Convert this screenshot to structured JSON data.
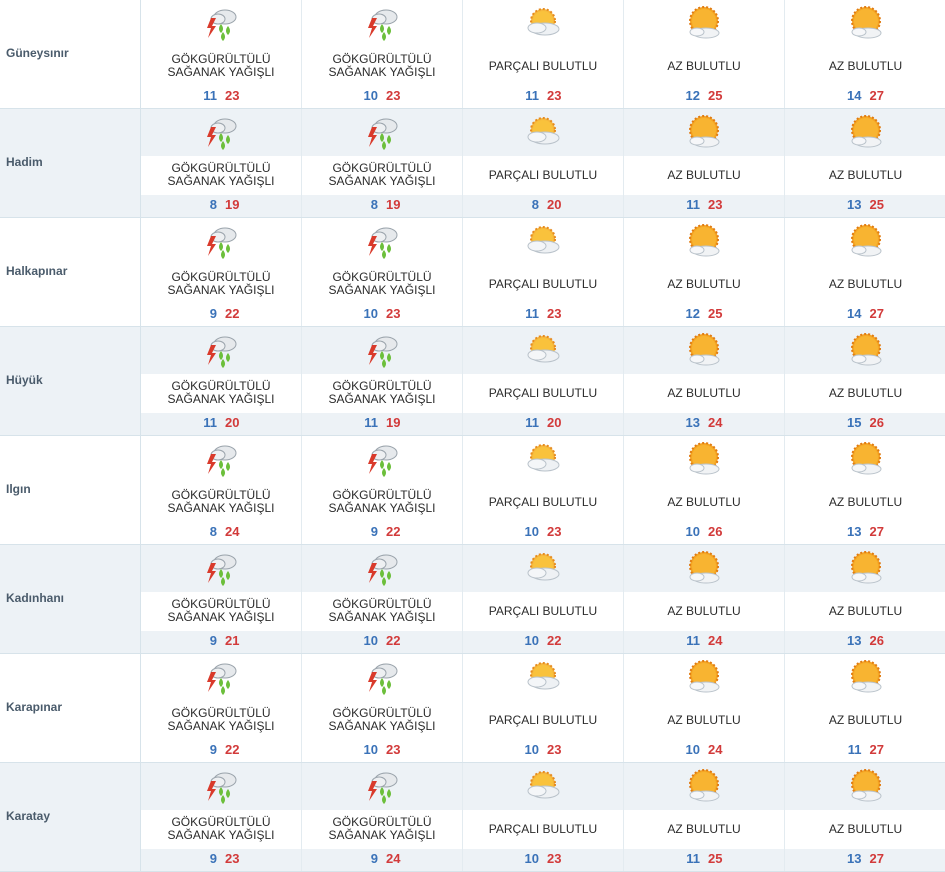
{
  "conditions": {
    "storm": "GÖKGÜRÜLTÜLÜ SAĞANAK YAĞIŞLI",
    "partly": "PARÇALI BULUTLU",
    "few": "AZ BULUTLU"
  },
  "rows": [
    {
      "name": "Güneysınır",
      "shaded": false,
      "days": [
        {
          "icon": "thunderstorm-icon",
          "cond": "GÖKGÜRÜLTÜLÜ SAĞANAK YAĞIŞLI",
          "min": "11",
          "max": "23"
        },
        {
          "icon": "thunderstorm-icon",
          "cond": "GÖKGÜRÜLTÜLÜ SAĞANAK YAĞIŞLI",
          "min": "10",
          "max": "23"
        },
        {
          "icon": "partly-cloudy-icon",
          "cond": "PARÇALI BULUTLU",
          "min": "11",
          "max": "23"
        },
        {
          "icon": "few-clouds-icon",
          "cond": "AZ BULUTLU",
          "min": "12",
          "max": "25"
        },
        {
          "icon": "few-clouds-icon",
          "cond": "AZ BULUTLU",
          "min": "14",
          "max": "27"
        }
      ]
    },
    {
      "name": "Hadim",
      "shaded": true,
      "days": [
        {
          "icon": "thunderstorm-icon",
          "cond": "GÖKGÜRÜLTÜLÜ SAĞANAK YAĞIŞLI",
          "min": "8",
          "max": "19"
        },
        {
          "icon": "thunderstorm-icon",
          "cond": "GÖKGÜRÜLTÜLÜ SAĞANAK YAĞIŞLI",
          "min": "8",
          "max": "19"
        },
        {
          "icon": "partly-cloudy-icon",
          "cond": "PARÇALI BULUTLU",
          "min": "8",
          "max": "20"
        },
        {
          "icon": "few-clouds-icon",
          "cond": "AZ BULUTLU",
          "min": "11",
          "max": "23"
        },
        {
          "icon": "few-clouds-icon",
          "cond": "AZ BULUTLU",
          "min": "13",
          "max": "25"
        }
      ]
    },
    {
      "name": "Halkapınar",
      "shaded": false,
      "days": [
        {
          "icon": "thunderstorm-icon",
          "cond": "GÖKGÜRÜLTÜLÜ SAĞANAK YAĞIŞLI",
          "min": "9",
          "max": "22"
        },
        {
          "icon": "thunderstorm-icon",
          "cond": "GÖKGÜRÜLTÜLÜ SAĞANAK YAĞIŞLI",
          "min": "10",
          "max": "23"
        },
        {
          "icon": "partly-cloudy-icon",
          "cond": "PARÇALI BULUTLU",
          "min": "11",
          "max": "23"
        },
        {
          "icon": "few-clouds-icon",
          "cond": "AZ BULUTLU",
          "min": "12",
          "max": "25"
        },
        {
          "icon": "few-clouds-icon",
          "cond": "AZ BULUTLU",
          "min": "14",
          "max": "27"
        }
      ]
    },
    {
      "name": "Hüyük",
      "shaded": true,
      "days": [
        {
          "icon": "thunderstorm-icon",
          "cond": "GÖKGÜRÜLTÜLÜ SAĞANAK YAĞIŞLI",
          "min": "11",
          "max": "20"
        },
        {
          "icon": "thunderstorm-icon",
          "cond": "GÖKGÜRÜLTÜLÜ SAĞANAK YAĞIŞLI",
          "min": "11",
          "max": "19"
        },
        {
          "icon": "partly-cloudy-icon",
          "cond": "PARÇALI BULUTLU",
          "min": "11",
          "max": "20"
        },
        {
          "icon": "few-clouds-icon",
          "cond": "AZ BULUTLU",
          "min": "13",
          "max": "24"
        },
        {
          "icon": "few-clouds-icon",
          "cond": "AZ BULUTLU",
          "min": "15",
          "max": "26"
        }
      ]
    },
    {
      "name": "Ilgın",
      "shaded": false,
      "days": [
        {
          "icon": "thunderstorm-icon",
          "cond": "GÖKGÜRÜLTÜLÜ SAĞANAK YAĞIŞLI",
          "min": "8",
          "max": "24"
        },
        {
          "icon": "thunderstorm-icon",
          "cond": "GÖKGÜRÜLTÜLÜ SAĞANAK YAĞIŞLI",
          "min": "9",
          "max": "22"
        },
        {
          "icon": "partly-cloudy-icon",
          "cond": "PARÇALI BULUTLU",
          "min": "10",
          "max": "23"
        },
        {
          "icon": "few-clouds-icon",
          "cond": "AZ BULUTLU",
          "min": "10",
          "max": "26"
        },
        {
          "icon": "few-clouds-icon",
          "cond": "AZ BULUTLU",
          "min": "13",
          "max": "27"
        }
      ]
    },
    {
      "name": "Kadınhanı",
      "shaded": true,
      "days": [
        {
          "icon": "thunderstorm-icon",
          "cond": "GÖKGÜRÜLTÜLÜ SAĞANAK YAĞIŞLI",
          "min": "9",
          "max": "21"
        },
        {
          "icon": "thunderstorm-icon",
          "cond": "GÖKGÜRÜLTÜLÜ SAĞANAK YAĞIŞLI",
          "min": "10",
          "max": "22"
        },
        {
          "icon": "partly-cloudy-icon",
          "cond": "PARÇALI BULUTLU",
          "min": "10",
          "max": "22"
        },
        {
          "icon": "few-clouds-icon",
          "cond": "AZ BULUTLU",
          "min": "11",
          "max": "24"
        },
        {
          "icon": "few-clouds-icon",
          "cond": "AZ BULUTLU",
          "min": "13",
          "max": "26"
        }
      ]
    },
    {
      "name": "Karapınar",
      "shaded": false,
      "days": [
        {
          "icon": "thunderstorm-icon",
          "cond": "GÖKGÜRÜLTÜLÜ SAĞANAK YAĞIŞLI",
          "min": "9",
          "max": "22"
        },
        {
          "icon": "thunderstorm-icon",
          "cond": "GÖKGÜRÜLTÜLÜ SAĞANAK YAĞIŞLI",
          "min": "10",
          "max": "23"
        },
        {
          "icon": "partly-cloudy-icon",
          "cond": "PARÇALI BULUTLU",
          "min": "10",
          "max": "23"
        },
        {
          "icon": "few-clouds-icon",
          "cond": "AZ BULUTLU",
          "min": "10",
          "max": "24"
        },
        {
          "icon": "few-clouds-icon",
          "cond": "AZ BULUTLU",
          "min": "11",
          "max": "27"
        }
      ]
    },
    {
      "name": "Karatay",
      "shaded": true,
      "days": [
        {
          "icon": "thunderstorm-icon",
          "cond": "GÖKGÜRÜLTÜLÜ SAĞANAK YAĞIŞLI",
          "min": "9",
          "max": "23"
        },
        {
          "icon": "thunderstorm-icon",
          "cond": "GÖKGÜRÜLTÜLÜ SAĞANAK YAĞIŞLI",
          "min": "9",
          "max": "24"
        },
        {
          "icon": "partly-cloudy-icon",
          "cond": "PARÇALI BULUTLU",
          "min": "10",
          "max": "23"
        },
        {
          "icon": "few-clouds-icon",
          "cond": "AZ BULUTLU",
          "min": "11",
          "max": "25"
        },
        {
          "icon": "few-clouds-icon",
          "cond": "AZ BULUTLU",
          "min": "13",
          "max": "27"
        }
      ]
    }
  ]
}
